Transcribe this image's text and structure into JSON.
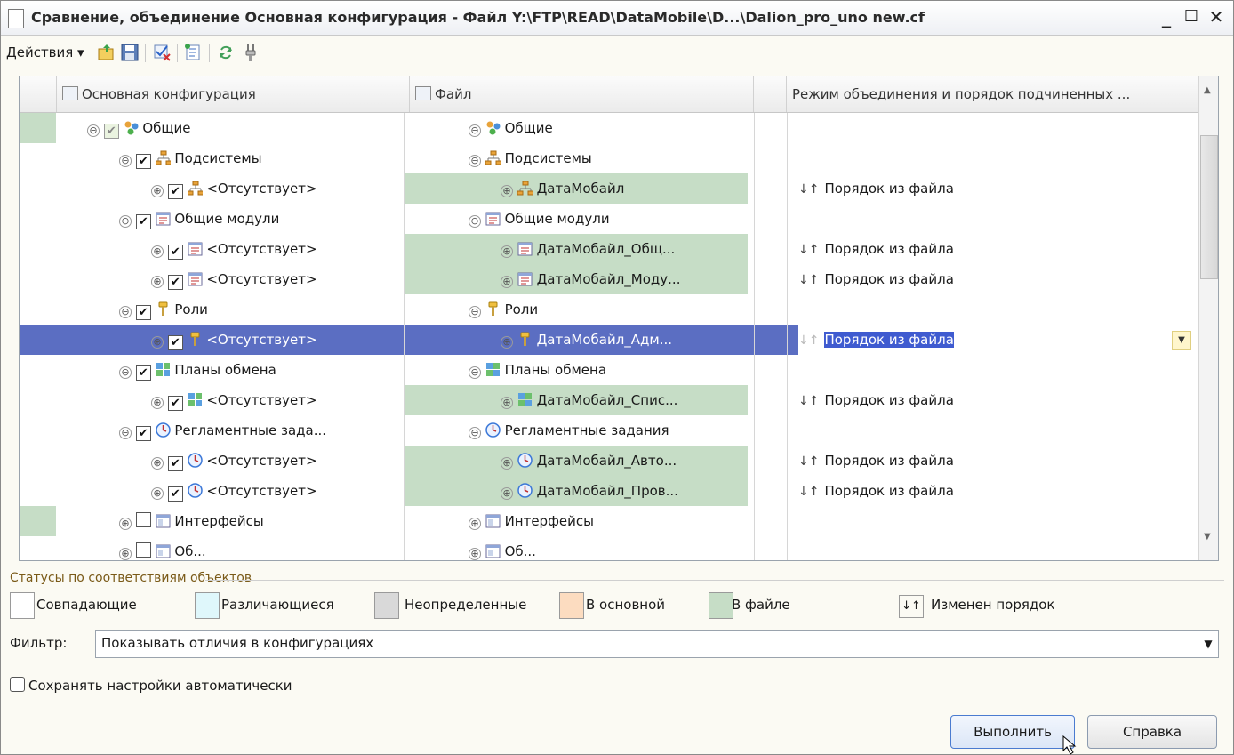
{
  "window": {
    "title": "Сравнение, объединение Основная конфигурация - Файл Y:\\FTP\\READ\\DataMobile\\D...\\Dalion_pro_uno new.cf",
    "minimize": "_",
    "maximize": "☐",
    "close": "✕"
  },
  "toolbar": {
    "actions_label": "Действия ▾",
    "icons": [
      "open-icon",
      "save-icon",
      "mark-icon",
      "tree-icon",
      "refresh-icon",
      "settings-icon"
    ]
  },
  "columns": {
    "main": "Основная конфигурация",
    "file": "Файл",
    "mode": "Режим объединения и порядок подчиненных ..."
  },
  "rows": [
    {
      "main": "Общие",
      "main_indent": 0,
      "main_check": "dim",
      "main_toggle": "⊖",
      "main_icon": "common",
      "file": "Общие",
      "file_toggle": "⊖",
      "file_green": false,
      "main_green_bar": true,
      "mode": ""
    },
    {
      "main": "Подсистемы",
      "main_indent": 1,
      "main_check": "on",
      "main_toggle": "⊖",
      "main_icon": "subsystem",
      "file": "Подсистемы",
      "file_toggle": "⊖",
      "file_green": false,
      "mode": ""
    },
    {
      "main": "<Отсутствует>",
      "main_indent": 2,
      "main_check": "on",
      "main_toggle": "⊕",
      "main_icon": "subsystem",
      "file": "ДатаМобайл",
      "file_toggle": "⊕",
      "file_green": true,
      "mode": "Порядок из файла"
    },
    {
      "main": "Общие модули",
      "main_indent": 1,
      "main_check": "on",
      "main_toggle": "⊖",
      "main_icon": "module",
      "file": "Общие модули",
      "file_toggle": "⊖",
      "file_green": false,
      "mode": ""
    },
    {
      "main": "<Отсутствует>",
      "main_indent": 2,
      "main_check": "on",
      "main_toggle": "⊕",
      "main_icon": "module",
      "file": "ДатаМобайл_Общ...",
      "file_toggle": "⊕",
      "file_green": true,
      "mode": "Порядок из файла"
    },
    {
      "main": "<Отсутствует>",
      "main_indent": 2,
      "main_check": "on",
      "main_toggle": "⊕",
      "main_icon": "module",
      "file": "ДатаМобайл_Моду...",
      "file_toggle": "⊕",
      "file_green": true,
      "mode": "Порядок из файла"
    },
    {
      "main": "Роли",
      "main_indent": 1,
      "main_check": "on",
      "main_toggle": "⊖",
      "main_icon": "role",
      "file": "Роли",
      "file_toggle": "⊖",
      "file_green": false,
      "mode": ""
    },
    {
      "main": "<Отсутствует>",
      "main_indent": 2,
      "main_check": "on",
      "main_toggle": "⊕",
      "main_icon": "role",
      "file": "ДатаМобайл_Адм...",
      "file_toggle": "⊕",
      "file_green": true,
      "mode": "Порядок из файла",
      "selected": true
    },
    {
      "main": "Планы обмена",
      "main_indent": 1,
      "main_check": "on",
      "main_toggle": "⊖",
      "main_icon": "exchange",
      "file": "Планы обмена",
      "file_toggle": "⊖",
      "file_green": false,
      "mode": ""
    },
    {
      "main": "<Отсутствует>",
      "main_indent": 2,
      "main_check": "on",
      "main_toggle": "⊕",
      "main_icon": "exchange",
      "file": "ДатаМобайл_Спис...",
      "file_toggle": "⊕",
      "file_green": true,
      "mode": "Порядок из файла"
    },
    {
      "main": "Регламентные зада...",
      "main_indent": 1,
      "main_check": "on",
      "main_toggle": "⊖",
      "main_icon": "clock",
      "file": "Регламентные задания",
      "file_toggle": "⊖",
      "file_green": false,
      "mode": ""
    },
    {
      "main": "<Отсутствует>",
      "main_indent": 2,
      "main_check": "on",
      "main_toggle": "⊕",
      "main_icon": "clock",
      "file": "ДатаМобайл_Авто...",
      "file_toggle": "⊕",
      "file_green": true,
      "mode": "Порядок из файла"
    },
    {
      "main": "<Отсутствует>",
      "main_indent": 2,
      "main_check": "on",
      "main_toggle": "⊕",
      "main_icon": "clock",
      "file": "ДатаМобайл_Пров...",
      "file_toggle": "⊕",
      "file_green": true,
      "mode": "Порядок из файла"
    },
    {
      "main": "Интерфейсы",
      "main_indent": 1,
      "main_check": "off",
      "main_toggle": "⊕",
      "main_icon": "interface",
      "file": "Интерфейсы",
      "file_toggle": "⊕",
      "file_green": false,
      "main_green_bar": true,
      "mode": ""
    },
    {
      "main": "Об...",
      "main_indent": 1,
      "main_check": "off",
      "main_toggle": "⊕",
      "main_icon": "interface",
      "file": "Об...",
      "file_toggle": "⊕",
      "file_green": false,
      "mode": ""
    }
  ],
  "legend": {
    "title": "Статусы по соответствиям объектов",
    "items": [
      {
        "label": "Совпадающие",
        "color": "#ffffff"
      },
      {
        "label": "Различающиеся",
        "color": "#dff7fb"
      },
      {
        "label": "Неопределенные",
        "color": "#d9d9d9"
      },
      {
        "label": "В основной",
        "color": "#fcdcc0"
      },
      {
        "label": "В файле",
        "color": "#c6ddc6"
      }
    ],
    "order_changed": "Изменен порядок"
  },
  "filter": {
    "label": "Фильтр:",
    "value": "Показывать отличия в конфигурациях"
  },
  "autosave_label": "Сохранять настройки автоматически",
  "buttons": {
    "run": "Выполнить",
    "help": "Справка"
  },
  "order_icon": "↓↑"
}
